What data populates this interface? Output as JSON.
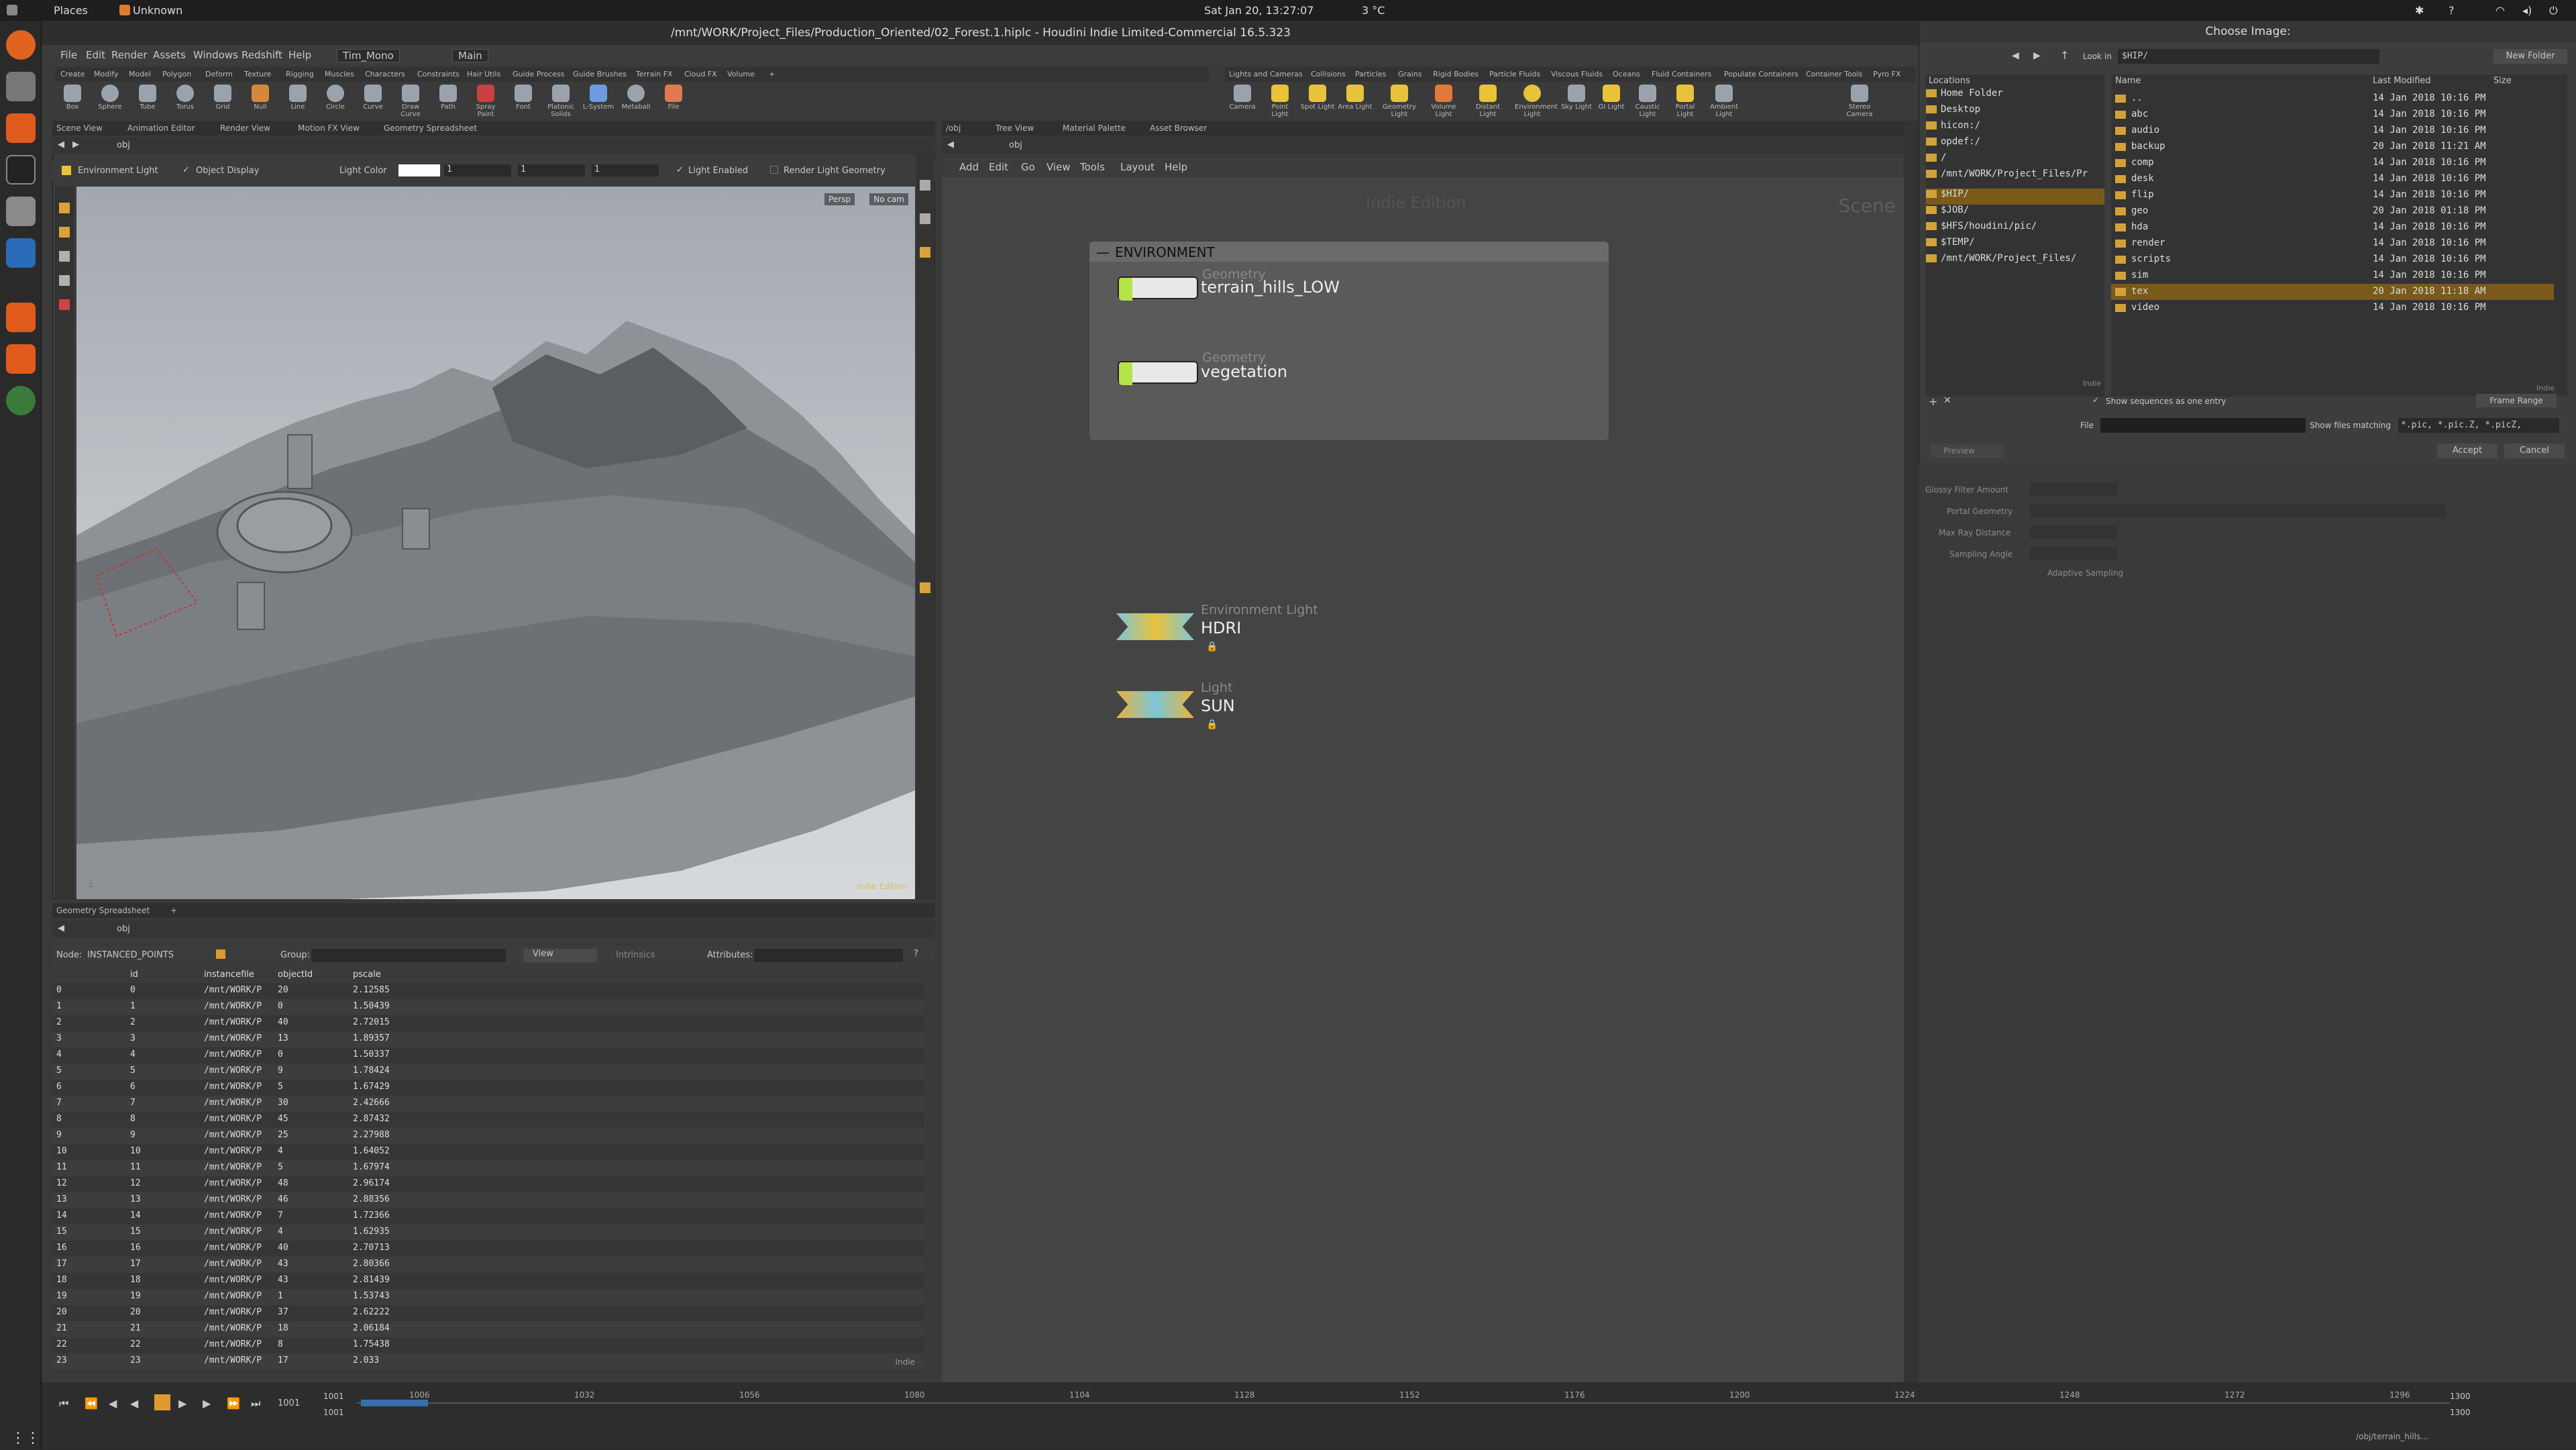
{
  "topbar": {
    "places": "Places",
    "unknown": "Unknown",
    "datetime": "Sat Jan 20, 13:27:07",
    "weather": "3 °C"
  },
  "app": {
    "title": "/mnt/WORK/Project_Files/Production_Oriented/02_Forest.1.hiplc - Houdini Indie Limited-Commercial 16.5.323",
    "menu": [
      "File",
      "Edit",
      "Render",
      "Assets",
      "Windows",
      "Redshift",
      "Help"
    ],
    "desktop": "Tim_Mono",
    "main_desktop": "Main"
  },
  "shelf_left": {
    "tabs": [
      "Create",
      "Modify",
      "Model",
      "Polygon",
      "Deform",
      "Texture",
      "Rigging",
      "Muscles",
      "Characters",
      "Constraints",
      "Hair Utils",
      "Guide Process",
      "Guide Brushes",
      "Terrain FX",
      "Cloud FX",
      "Volume"
    ],
    "tools": [
      "Box",
      "Sphere",
      "Tube",
      "Torus",
      "Grid",
      "Null",
      "Line",
      "Circle",
      "Curve",
      "Draw Curve",
      "Path",
      "Spray Paint",
      "Font",
      "Platonic Solids",
      "L-System",
      "Metaball",
      "File"
    ]
  },
  "shelf_right": {
    "tabs": [
      "Lights and Cameras",
      "Collisions",
      "Particles",
      "Grains",
      "Rigid Bodies",
      "Particle Fluids",
      "Viscous Fluids",
      "Oceans",
      "Fluid Containers",
      "Populate Containers",
      "Container Tools",
      "Pyro FX"
    ],
    "tools": [
      "Camera",
      "Point Light",
      "Spot Light",
      "Area Light",
      "Geometry Light",
      "Volume Light",
      "Distant Light",
      "Environment Light",
      "Sky Light",
      "GI Light",
      "Caustic Light",
      "Portal Light",
      "Ambient Light",
      "Stereo Camera"
    ]
  },
  "viewer": {
    "tabs": [
      "Scene View",
      "Animation Editor",
      "Render View",
      "Motion FX View",
      "Geometry Spreadsheet"
    ],
    "path": "obj",
    "light_name": "Environment Light",
    "object_display": "Object Display",
    "light_color_label": "Light Color",
    "light_color_values": [
      "1",
      "1",
      "1"
    ],
    "light_enabled": "Light Enabled",
    "render_light_geometry": "Render Light Geometry",
    "persp": "Persp",
    "nocam": "No cam",
    "indie_edition": "Indie Edition"
  },
  "spreadsheet": {
    "tab": "Geometry Spreadsheet",
    "path": "obj",
    "node_label": "Node:",
    "node_name": "INSTANCED_POINTS",
    "group_label": "Group:",
    "view_label": "View",
    "intrinsics": "Intrinsics",
    "attributes_label": "Attributes:",
    "columns": [
      "id",
      "instancefile",
      "objectId",
      "pscale"
    ],
    "rows": [
      [
        "0",
        "0",
        "/mnt/WORK/P",
        "20",
        "2.12585"
      ],
      [
        "1",
        "1",
        "/mnt/WORK/P",
        "0",
        "1.50439"
      ],
      [
        "2",
        "2",
        "/mnt/WORK/P",
        "40",
        "2.72015"
      ],
      [
        "3",
        "3",
        "/mnt/WORK/P",
        "13",
        "1.89357"
      ],
      [
        "4",
        "4",
        "/mnt/WORK/P",
        "0",
        "1.50337"
      ],
      [
        "5",
        "5",
        "/mnt/WORK/P",
        "9",
        "1.78424"
      ],
      [
        "6",
        "6",
        "/mnt/WORK/P",
        "5",
        "1.67429"
      ],
      [
        "7",
        "7",
        "/mnt/WORK/P",
        "30",
        "2.42666"
      ],
      [
        "8",
        "8",
        "/mnt/WORK/P",
        "45",
        "2.87432"
      ],
      [
        "9",
        "9",
        "/mnt/WORK/P",
        "25",
        "2.27988"
      ],
      [
        "10",
        "10",
        "/mnt/WORK/P",
        "4",
        "1.64052"
      ],
      [
        "11",
        "11",
        "/mnt/WORK/P",
        "5",
        "1.67974"
      ],
      [
        "12",
        "12",
        "/mnt/WORK/P",
        "48",
        "2.96174"
      ],
      [
        "13",
        "13",
        "/mnt/WORK/P",
        "46",
        "2.88356"
      ],
      [
        "14",
        "14",
        "/mnt/WORK/P",
        "7",
        "1.72366"
      ],
      [
        "15",
        "15",
        "/mnt/WORK/P",
        "4",
        "1.62935"
      ],
      [
        "16",
        "16",
        "/mnt/WORK/P",
        "40",
        "2.70713"
      ],
      [
        "17",
        "17",
        "/mnt/WORK/P",
        "43",
        "2.80366"
      ],
      [
        "18",
        "18",
        "/mnt/WORK/P",
        "43",
        "2.81439"
      ],
      [
        "19",
        "19",
        "/mnt/WORK/P",
        "1",
        "1.53743"
      ],
      [
        "20",
        "20",
        "/mnt/WORK/P",
        "37",
        "2.62222"
      ],
      [
        "21",
        "21",
        "/mnt/WORK/P",
        "18",
        "2.06184"
      ],
      [
        "22",
        "22",
        "/mnt/WORK/P",
        "8",
        "1.75438"
      ],
      [
        "23",
        "23",
        "/mnt/WORK/P",
        "17",
        "2.033"
      ]
    ],
    "indie": "Indie"
  },
  "network": {
    "tabs": [
      "/obj",
      "Tree View",
      "Material Palette",
      "Asset Browser"
    ],
    "path": "obj",
    "menu": [
      "Add",
      "Edit",
      "Go",
      "View",
      "Tools",
      "Layout",
      "Help"
    ],
    "watermark": "Indie Edition",
    "scene_label": "Scene",
    "box_title": "ENVIRONMENT",
    "nodes": [
      {
        "type": "Geometry",
        "name": "terrain_hills_LOW"
      },
      {
        "type": "Geometry",
        "name": "vegetation"
      },
      {
        "type": "Environment Light",
        "name": "HDRI"
      },
      {
        "type": "Light",
        "name": "SUN"
      }
    ]
  },
  "dialog": {
    "title": "Choose Image:",
    "look_in_label": "Look in",
    "look_in_value": "$HIP/",
    "new_folder": "New Folder",
    "locations_header": "Locations",
    "locations": [
      "Home Folder",
      "Desktop",
      "hicon:/",
      "opdef:/",
      "/",
      "/mnt/WORK/Project_Files/Pr",
      "$HIP/",
      "$JOB/",
      "$HFS/houdini/pic/",
      "$TEMP/",
      "/mnt/WORK/Project_Files/"
    ],
    "col_name": "Name",
    "col_modified": "Last Modified",
    "col_size": "Size",
    "files": [
      {
        "name": "..",
        "modified": "14 Jan 2018 10:16 PM"
      },
      {
        "name": "abc",
        "modified": "14 Jan 2018 10:16 PM"
      },
      {
        "name": "audio",
        "modified": "14 Jan 2018 10:16 PM"
      },
      {
        "name": "backup",
        "modified": "20 Jan 2018 11:21 AM"
      },
      {
        "name": "comp",
        "modified": "14 Jan 2018 10:16 PM"
      },
      {
        "name": "desk",
        "modified": "14 Jan 2018 10:16 PM"
      },
      {
        "name": "flip",
        "modified": "14 Jan 2018 10:16 PM"
      },
      {
        "name": "geo",
        "modified": "20 Jan 2018 01:18 PM"
      },
      {
        "name": "hda",
        "modified": "14 Jan 2018 10:16 PM"
      },
      {
        "name": "render",
        "modified": "14 Jan 2018 10:16 PM"
      },
      {
        "name": "scripts",
        "modified": "14 Jan 2018 10:16 PM"
      },
      {
        "name": "sim",
        "modified": "14 Jan 2018 10:16 PM"
      },
      {
        "name": "tex",
        "modified": "20 Jan 2018 11:18 AM"
      },
      {
        "name": "video",
        "modified": "14 Jan 2018 10:16 PM"
      }
    ],
    "indie_left": "Indie",
    "indie_right": "Indie",
    "show_sequences": "Show sequences as one entry",
    "frame_range": "Frame Range",
    "file_label": "File",
    "show_files_matching": "Show files matching",
    "file_filter": "*.pic, *.pic.Z, *.picZ,",
    "preview": "Preview",
    "accept": "Accept",
    "cancel": "Cancel"
  },
  "props": {
    "glossy_filter": "Glossy Filter Amount",
    "portal_geometry": "Portal Geometry",
    "max_ray_distance": "Max Ray Distance",
    "sampling_angle": "Sampling Angle",
    "adaptive_sampling": "Adaptive Sampling"
  },
  "timeline": {
    "frame_start": "1001",
    "frame_end": "1001",
    "current": "1001",
    "ticks": [
      "1006",
      "1032",
      "1056",
      "1080",
      "1104",
      "1128",
      "1152",
      "1176",
      "1200",
      "1224",
      "1248",
      "1272",
      "1296"
    ],
    "end_a": "1300",
    "end_b": "1300",
    "status_path": "/obj/terrain_hills..."
  }
}
